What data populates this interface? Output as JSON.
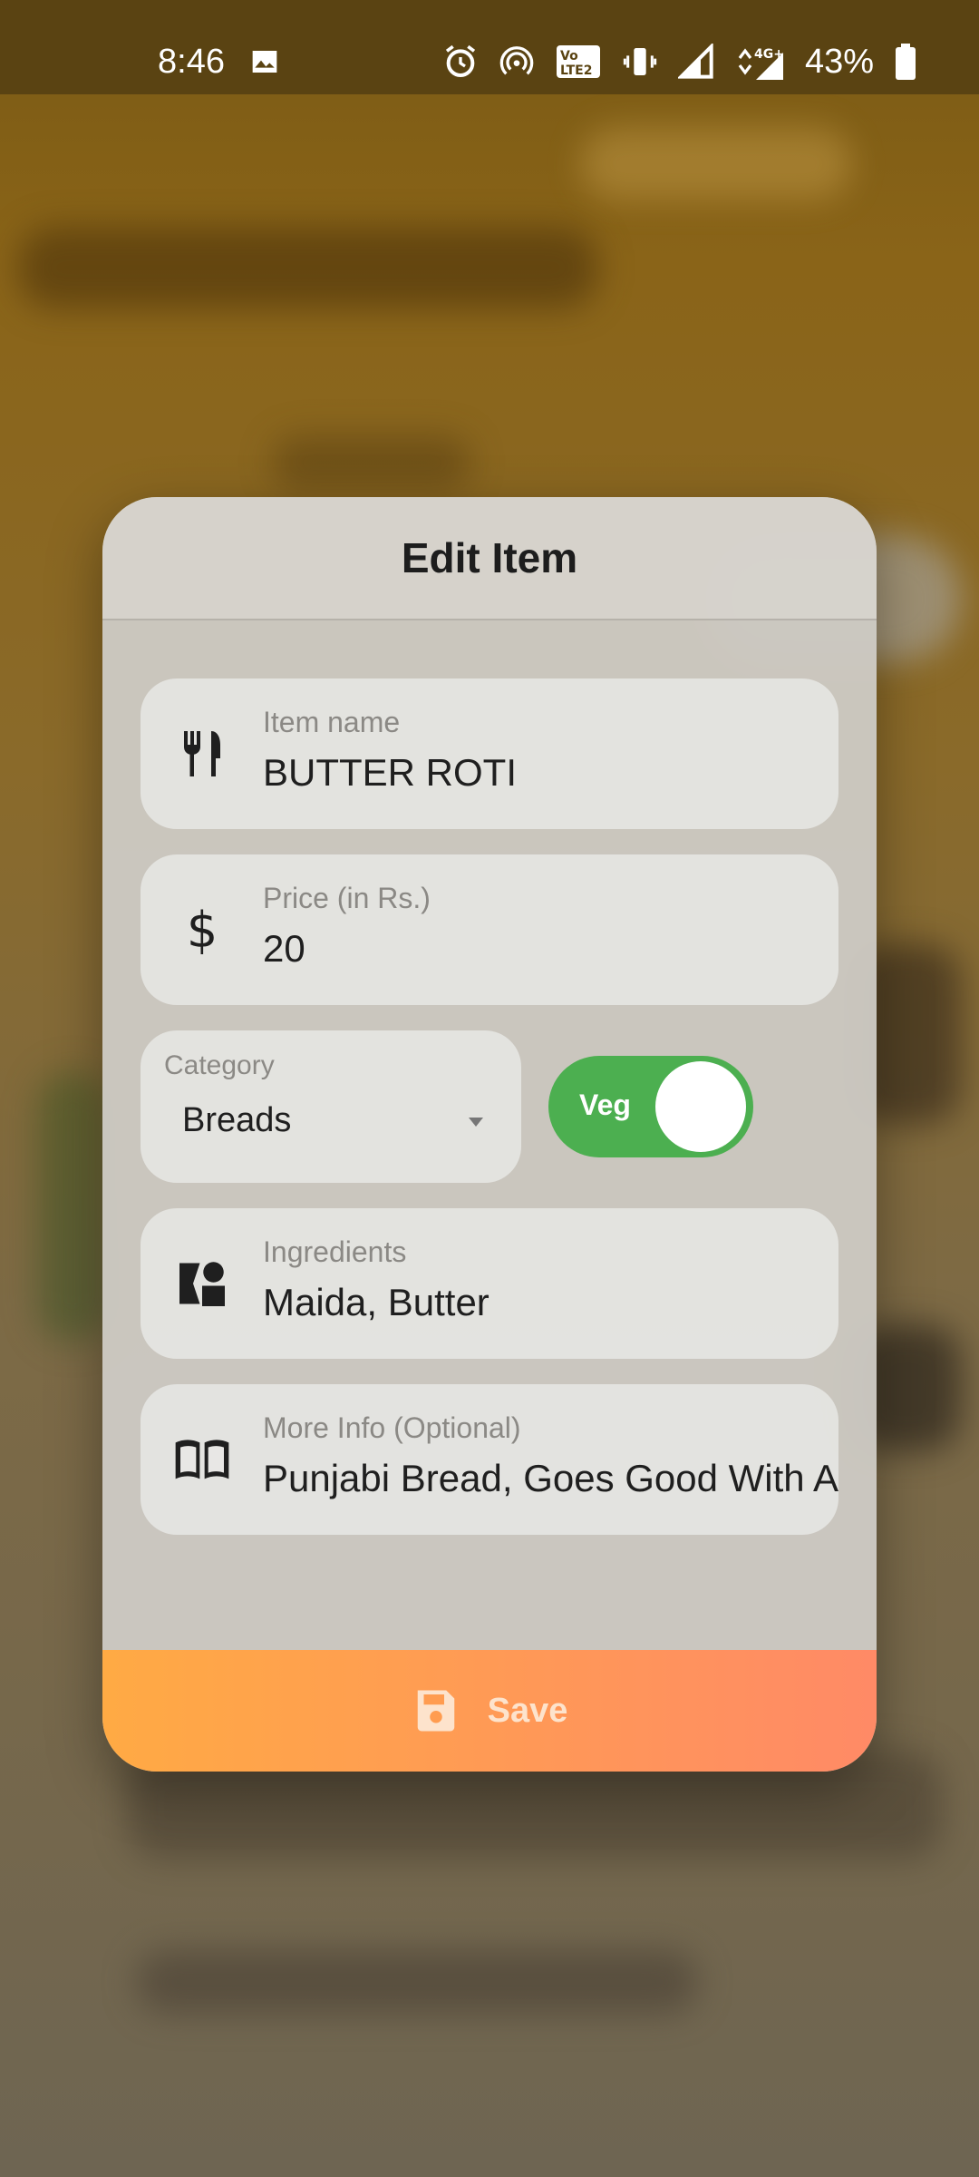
{
  "status_bar": {
    "time": "8:46",
    "battery": "43%",
    "network": "4G+",
    "icons": [
      "image-icon",
      "alarm-icon",
      "hotspot-icon",
      "volte-icon",
      "vibrate-icon",
      "signal-icon",
      "data-icon",
      "battery-icon"
    ]
  },
  "dialog": {
    "title": "Edit Item",
    "fields": {
      "item_name": {
        "label": "Item name",
        "value": "BUTTER ROTI",
        "icon": "fork-knife-icon"
      },
      "price": {
        "label": "Price (in Rs.)",
        "value": "20",
        "icon": "dollar-icon"
      },
      "category": {
        "label": "Category",
        "value": "Breads"
      },
      "veg_toggle": {
        "label": "Veg",
        "on": true
      },
      "ingredients": {
        "label": "Ingredients",
        "value": "Maida, Butter",
        "icon": "ingredients-icon"
      },
      "more_info": {
        "label": "More Info (Optional)",
        "value": "Punjabi Bread, Goes Good With A",
        "icon": "book-icon"
      }
    },
    "save_label": "Save"
  },
  "colors": {
    "toggle_on": "#4caf50",
    "save_gradient_start": "#ffaa44",
    "save_gradient_end": "#ff8a66"
  }
}
